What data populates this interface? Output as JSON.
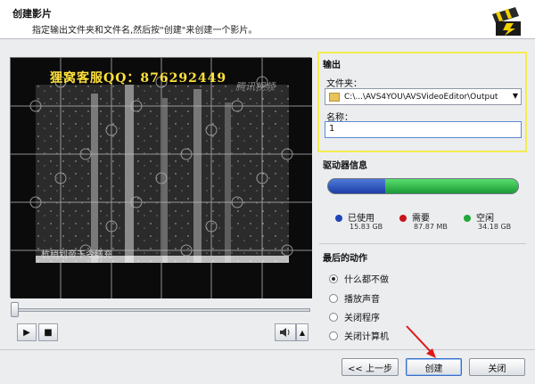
{
  "header": {
    "title": "创建影片",
    "subtitle": "指定输出文件夹和文件名,然后按\"创建\"来创建一个影片。",
    "logo_icon": "film-clapper-icon"
  },
  "preview": {
    "overlay_text": "狸窝客服QQ：876292449",
    "watermark": "腾讯视频",
    "subtitle_text": "杭稍划帝干令缮充"
  },
  "player": {
    "play_icon": "▶",
    "stop_icon": "■",
    "volume_icon": "speaker-icon",
    "volume_arrow": "▲"
  },
  "output": {
    "section_label": "输出",
    "folder_label": "文件夹：",
    "folder_value": "C:\\...\\AVS4YOU\\AVSVideoEditor\\Output",
    "name_label": "名称：",
    "name_value": "1"
  },
  "drive": {
    "section_label": "驱动器信息",
    "used_fraction": 0.3,
    "needed_fraction": 0.002,
    "items": [
      {
        "label": "已使用",
        "value": "15.83 GB",
        "color": "#1f45b8"
      },
      {
        "label": "需要",
        "value": "87.87 MB",
        "color": "#c8141e"
      },
      {
        "label": "空闲",
        "value": "34.18 GB",
        "color": "#22a839"
      }
    ]
  },
  "final_action": {
    "section_label": "最后的动作",
    "options": [
      {
        "label": "什么都不做",
        "checked": true
      },
      {
        "label": "播放声音",
        "checked": false
      },
      {
        "label": "关闭程序",
        "checked": false
      },
      {
        "label": "关闭计算机",
        "checked": false
      }
    ]
  },
  "buttons": {
    "back": "<< 上一步",
    "create": "创建",
    "close": "关闭"
  },
  "colors": {
    "highlight": "#f2ec50",
    "arrow": "#e01818"
  }
}
